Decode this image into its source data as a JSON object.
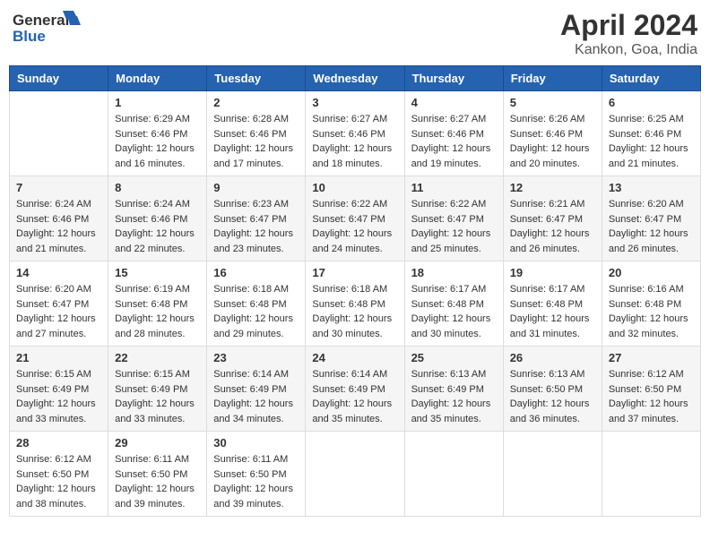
{
  "header": {
    "logo_general": "General",
    "logo_blue": "Blue",
    "title": "April 2024",
    "subtitle": "Kankon, Goa, India"
  },
  "columns": [
    "Sunday",
    "Monday",
    "Tuesday",
    "Wednesday",
    "Thursday",
    "Friday",
    "Saturday"
  ],
  "weeks": [
    {
      "shade": "white",
      "days": [
        {
          "number": "",
          "sunrise": "",
          "sunset": "",
          "daylight": ""
        },
        {
          "number": "1",
          "sunrise": "Sunrise: 6:29 AM",
          "sunset": "Sunset: 6:46 PM",
          "daylight": "Daylight: 12 hours and 16 minutes."
        },
        {
          "number": "2",
          "sunrise": "Sunrise: 6:28 AM",
          "sunset": "Sunset: 6:46 PM",
          "daylight": "Daylight: 12 hours and 17 minutes."
        },
        {
          "number": "3",
          "sunrise": "Sunrise: 6:27 AM",
          "sunset": "Sunset: 6:46 PM",
          "daylight": "Daylight: 12 hours and 18 minutes."
        },
        {
          "number": "4",
          "sunrise": "Sunrise: 6:27 AM",
          "sunset": "Sunset: 6:46 PM",
          "daylight": "Daylight: 12 hours and 19 minutes."
        },
        {
          "number": "5",
          "sunrise": "Sunrise: 6:26 AM",
          "sunset": "Sunset: 6:46 PM",
          "daylight": "Daylight: 12 hours and 20 minutes."
        },
        {
          "number": "6",
          "sunrise": "Sunrise: 6:25 AM",
          "sunset": "Sunset: 6:46 PM",
          "daylight": "Daylight: 12 hours and 21 minutes."
        }
      ]
    },
    {
      "shade": "shaded",
      "days": [
        {
          "number": "7",
          "sunrise": "Sunrise: 6:24 AM",
          "sunset": "Sunset: 6:46 PM",
          "daylight": "Daylight: 12 hours and 21 minutes."
        },
        {
          "number": "8",
          "sunrise": "Sunrise: 6:24 AM",
          "sunset": "Sunset: 6:46 PM",
          "daylight": "Daylight: 12 hours and 22 minutes."
        },
        {
          "number": "9",
          "sunrise": "Sunrise: 6:23 AM",
          "sunset": "Sunset: 6:47 PM",
          "daylight": "Daylight: 12 hours and 23 minutes."
        },
        {
          "number": "10",
          "sunrise": "Sunrise: 6:22 AM",
          "sunset": "Sunset: 6:47 PM",
          "daylight": "Daylight: 12 hours and 24 minutes."
        },
        {
          "number": "11",
          "sunrise": "Sunrise: 6:22 AM",
          "sunset": "Sunset: 6:47 PM",
          "daylight": "Daylight: 12 hours and 25 minutes."
        },
        {
          "number": "12",
          "sunrise": "Sunrise: 6:21 AM",
          "sunset": "Sunset: 6:47 PM",
          "daylight": "Daylight: 12 hours and 26 minutes."
        },
        {
          "number": "13",
          "sunrise": "Sunrise: 6:20 AM",
          "sunset": "Sunset: 6:47 PM",
          "daylight": "Daylight: 12 hours and 26 minutes."
        }
      ]
    },
    {
      "shade": "white",
      "days": [
        {
          "number": "14",
          "sunrise": "Sunrise: 6:20 AM",
          "sunset": "Sunset: 6:47 PM",
          "daylight": "Daylight: 12 hours and 27 minutes."
        },
        {
          "number": "15",
          "sunrise": "Sunrise: 6:19 AM",
          "sunset": "Sunset: 6:48 PM",
          "daylight": "Daylight: 12 hours and 28 minutes."
        },
        {
          "number": "16",
          "sunrise": "Sunrise: 6:18 AM",
          "sunset": "Sunset: 6:48 PM",
          "daylight": "Daylight: 12 hours and 29 minutes."
        },
        {
          "number": "17",
          "sunrise": "Sunrise: 6:18 AM",
          "sunset": "Sunset: 6:48 PM",
          "daylight": "Daylight: 12 hours and 30 minutes."
        },
        {
          "number": "18",
          "sunrise": "Sunrise: 6:17 AM",
          "sunset": "Sunset: 6:48 PM",
          "daylight": "Daylight: 12 hours and 30 minutes."
        },
        {
          "number": "19",
          "sunrise": "Sunrise: 6:17 AM",
          "sunset": "Sunset: 6:48 PM",
          "daylight": "Daylight: 12 hours and 31 minutes."
        },
        {
          "number": "20",
          "sunrise": "Sunrise: 6:16 AM",
          "sunset": "Sunset: 6:48 PM",
          "daylight": "Daylight: 12 hours and 32 minutes."
        }
      ]
    },
    {
      "shade": "shaded",
      "days": [
        {
          "number": "21",
          "sunrise": "Sunrise: 6:15 AM",
          "sunset": "Sunset: 6:49 PM",
          "daylight": "Daylight: 12 hours and 33 minutes."
        },
        {
          "number": "22",
          "sunrise": "Sunrise: 6:15 AM",
          "sunset": "Sunset: 6:49 PM",
          "daylight": "Daylight: 12 hours and 33 minutes."
        },
        {
          "number": "23",
          "sunrise": "Sunrise: 6:14 AM",
          "sunset": "Sunset: 6:49 PM",
          "daylight": "Daylight: 12 hours and 34 minutes."
        },
        {
          "number": "24",
          "sunrise": "Sunrise: 6:14 AM",
          "sunset": "Sunset: 6:49 PM",
          "daylight": "Daylight: 12 hours and 35 minutes."
        },
        {
          "number": "25",
          "sunrise": "Sunrise: 6:13 AM",
          "sunset": "Sunset: 6:49 PM",
          "daylight": "Daylight: 12 hours and 35 minutes."
        },
        {
          "number": "26",
          "sunrise": "Sunrise: 6:13 AM",
          "sunset": "Sunset: 6:50 PM",
          "daylight": "Daylight: 12 hours and 36 minutes."
        },
        {
          "number": "27",
          "sunrise": "Sunrise: 6:12 AM",
          "sunset": "Sunset: 6:50 PM",
          "daylight": "Daylight: 12 hours and 37 minutes."
        }
      ]
    },
    {
      "shade": "white",
      "days": [
        {
          "number": "28",
          "sunrise": "Sunrise: 6:12 AM",
          "sunset": "Sunset: 6:50 PM",
          "daylight": "Daylight: 12 hours and 38 minutes."
        },
        {
          "number": "29",
          "sunrise": "Sunrise: 6:11 AM",
          "sunset": "Sunset: 6:50 PM",
          "daylight": "Daylight: 12 hours and 39 minutes."
        },
        {
          "number": "30",
          "sunrise": "Sunrise: 6:11 AM",
          "sunset": "Sunset: 6:50 PM",
          "daylight": "Daylight: 12 hours and 39 minutes."
        },
        {
          "number": "",
          "sunrise": "",
          "sunset": "",
          "daylight": ""
        },
        {
          "number": "",
          "sunrise": "",
          "sunset": "",
          "daylight": ""
        },
        {
          "number": "",
          "sunrise": "",
          "sunset": "",
          "daylight": ""
        },
        {
          "number": "",
          "sunrise": "",
          "sunset": "",
          "daylight": ""
        }
      ]
    }
  ]
}
